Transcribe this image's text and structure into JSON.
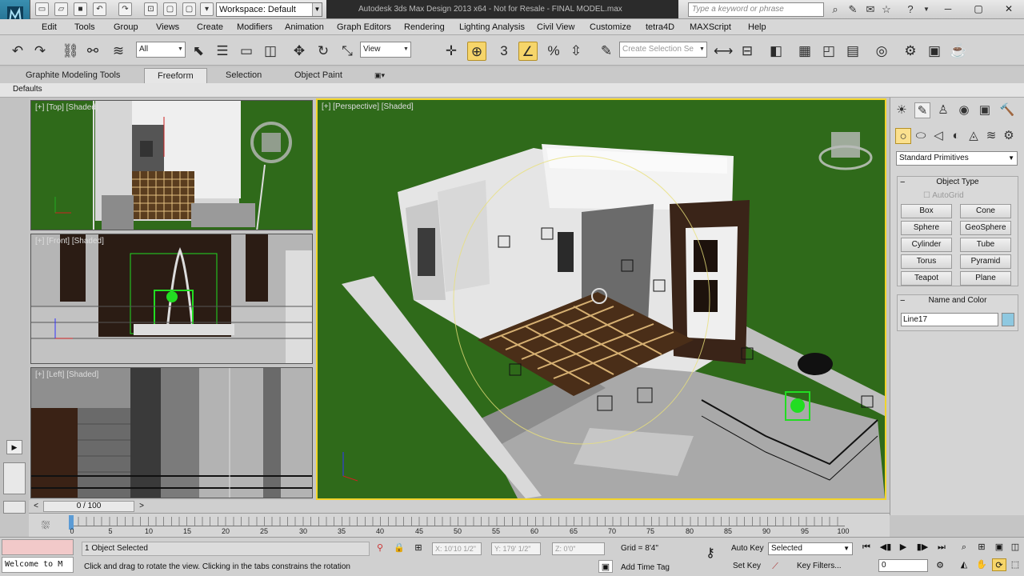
{
  "title_bar": {
    "workspace": "Workspace: Default",
    "app_title": "Autodesk 3ds Max Design 2013 x64 - Not for Resale - FINAL MODEL.max",
    "search_placeholder": "Type a keyword or phrase"
  },
  "menu": [
    "Edit",
    "Tools",
    "Group",
    "Views",
    "Create",
    "Modifiers",
    "Animation",
    "Graph Editors",
    "Rendering",
    "Lighting Analysis",
    "Civil View",
    "Customize",
    "tetra4D",
    "MAXScript",
    "Help"
  ],
  "toolbar": {
    "selection_filter": "All",
    "reference_coord": "View",
    "named_selection_placeholder": "Create Selection Se",
    "snap_label": "3"
  },
  "ribbon": {
    "tabs": [
      "Graphite Modeling Tools",
      "Freeform",
      "Selection",
      "Object Paint"
    ],
    "active_tab": "Freeform",
    "panel_label": "Defaults"
  },
  "viewports": {
    "top": "[+] [Top] [Shaded]",
    "front": "[+] [Front] [Shaded]",
    "left": "[+] [Left] [Shaded]",
    "perspective": "[+] [Perspective] [Shaded]"
  },
  "command_panel": {
    "category": "Standard Primitives",
    "object_type_header": "Object Type",
    "autogrid": "AutoGrid",
    "buttons": [
      "Box",
      "Cone",
      "Sphere",
      "GeoSphere",
      "Cylinder",
      "Tube",
      "Torus",
      "Pyramid",
      "Teapot",
      "Plane"
    ],
    "name_color_header": "Name and Color",
    "object_name": "Line17",
    "object_color": "#8ec8e0"
  },
  "timeline": {
    "frame": "0 / 100",
    "ticks": [
      "0",
      "5",
      "10",
      "15",
      "20",
      "25",
      "30",
      "35",
      "40",
      "45",
      "50",
      "55",
      "60",
      "65",
      "70",
      "75",
      "80",
      "85",
      "90",
      "95",
      "100"
    ]
  },
  "status": {
    "maxscript": "Welcome to M",
    "selection": "1 Object Selected",
    "prompt": "Click and drag to rotate the view.  Clicking in the tabs constrains the rotation",
    "x": "X: 10'10 1/2\"",
    "y": "Y: 179' 1/2\"",
    "z": "Z: 0'0\"",
    "grid": "Grid = 8'4\"",
    "add_time_tag": "Add Time Tag",
    "auto_key": "Auto Key",
    "set_key": "Set Key",
    "key_mode": "Selected",
    "key_filters": "Key Filters...",
    "current_frame": "0"
  },
  "colors": {
    "grass": "#2f6a1a",
    "viewport_active_border": "#f2d42a",
    "selection_green": "#22dd22"
  }
}
